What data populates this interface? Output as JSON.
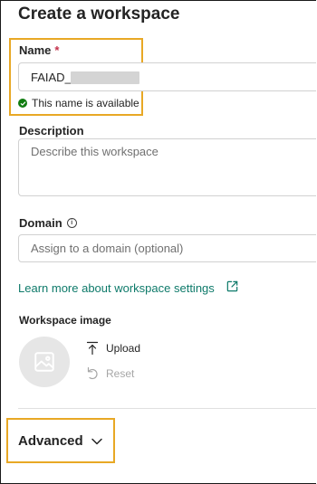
{
  "panel": {
    "title": "Create a workspace"
  },
  "name_field": {
    "label": "Name",
    "required_marker": "*",
    "value": "FAIAD_",
    "status": "This name is available"
  },
  "description_field": {
    "label": "Description",
    "placeholder": "Describe this workspace"
  },
  "domain_field": {
    "label": "Domain",
    "placeholder": "Assign to a domain (optional)"
  },
  "learn_more": {
    "label": "Learn more about workspace settings"
  },
  "workspace_image": {
    "label": "Workspace image",
    "upload_label": "Upload",
    "reset_label": "Reset"
  },
  "advanced": {
    "label": "Advanced"
  },
  "colors": {
    "highlight": "#e8a825",
    "link": "#0e7a6a",
    "success": "#107c10",
    "required": "#c4314b"
  }
}
